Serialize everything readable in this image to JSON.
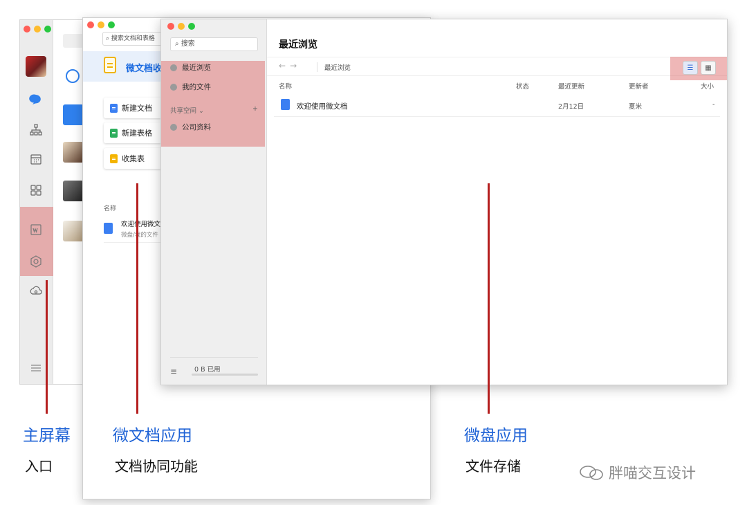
{
  "wedoc": {
    "search_placeholder": "搜索文档和表格",
    "title": "微文档收",
    "buttons": [
      {
        "label": "新建文档"
      },
      {
        "label": "新建表格"
      },
      {
        "label": "收集表"
      }
    ],
    "list_header": "名称",
    "item": {
      "name": "欢迎使用微文",
      "path": "微盘/我的文件"
    }
  },
  "wedrive": {
    "search_placeholder": "搜索",
    "sidebar": {
      "recent": "最近浏览",
      "my_files": "我的文件",
      "shared_label": "共享空间",
      "shared_add": "+",
      "company": "公司资料"
    },
    "usage": "0 B 已用",
    "page_title": "最近浏览",
    "nav_back": "←",
    "nav_forward": "→",
    "breadcrumb": "最近浏览",
    "view_list_icon": "list-icon",
    "view_grid_icon": "grid-icon",
    "columns": {
      "name": "名称",
      "status": "状态",
      "updated": "最近更新",
      "updater": "更新者",
      "size": "大小"
    },
    "files": [
      {
        "name": "欢迎使用微文档",
        "status": "",
        "updated": "2月12日",
        "updater": "夏米",
        "size": "-"
      }
    ]
  },
  "captions": {
    "home_title": "主屏幕",
    "home_sub": "入口",
    "doc_title": "微文档应用",
    "doc_sub": "文档协同功能",
    "drive_title": "微盘应用",
    "drive_sub": "文件存储"
  },
  "watermark": "胖喵交互设计",
  "colors": {
    "highlight": "#dc5f5f",
    "callout_line": "#b51f1f",
    "caption_blue": "#1f63d6",
    "doc_blue": "#3b7ff2"
  }
}
